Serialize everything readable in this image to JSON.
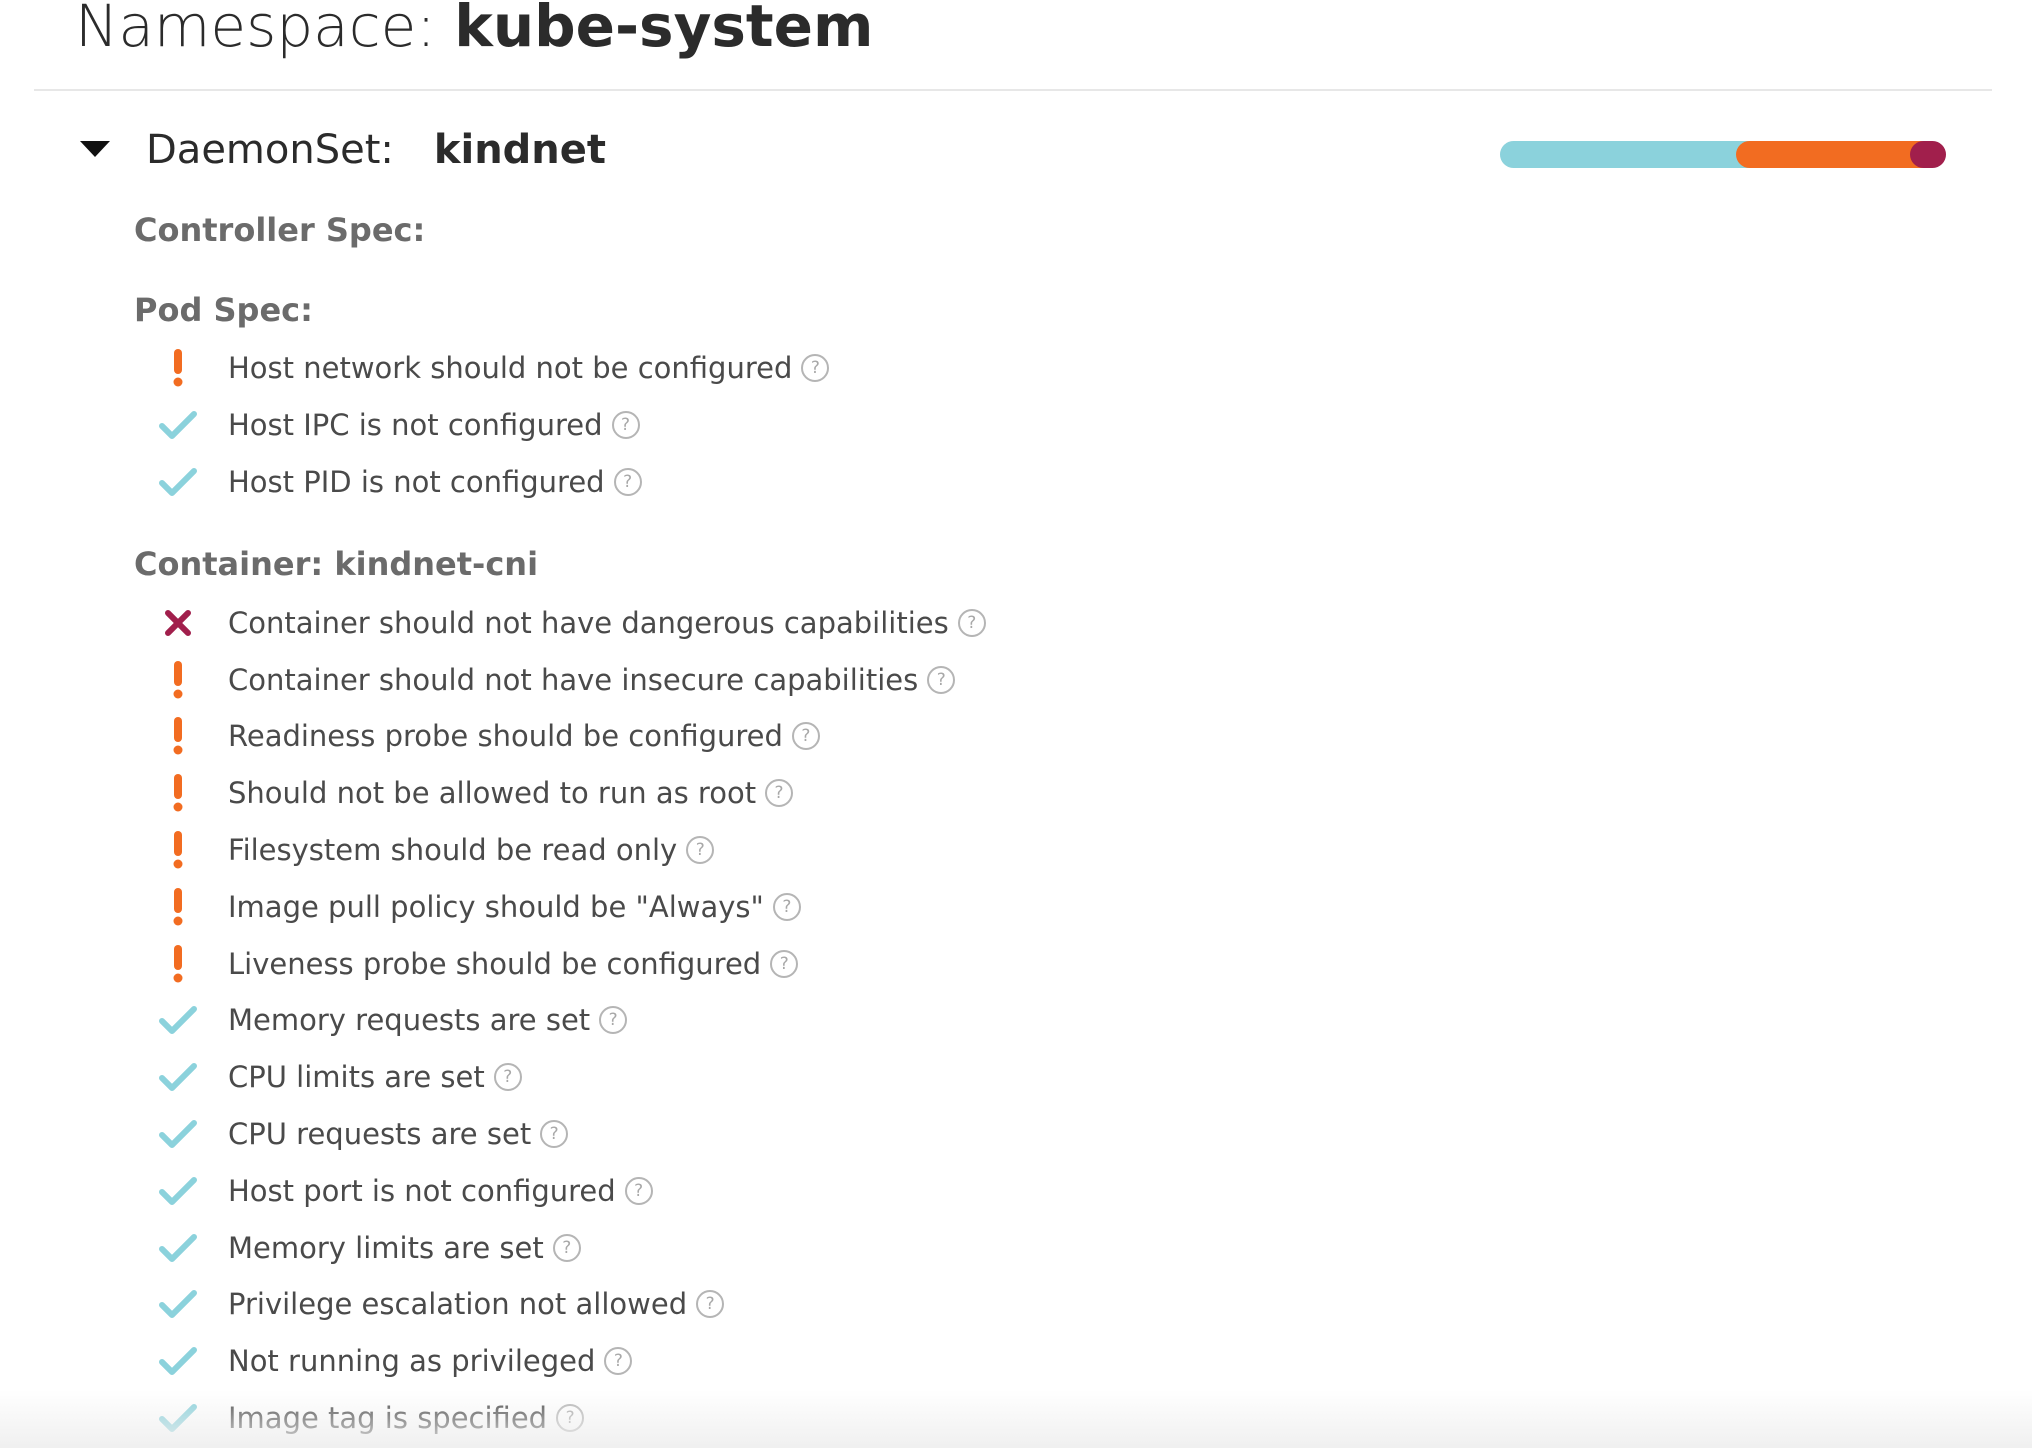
{
  "namespace": {
    "label": "Namespace:",
    "name": "kube-system"
  },
  "controller": {
    "kind_label": "DaemonSet:",
    "name": "kindnet",
    "expanded": true,
    "toggle_icon": "caret-down-icon",
    "score_bar": {
      "success_fraction": 0.56,
      "warning_fraction": 0.39,
      "danger_fraction": 0.05,
      "colors": {
        "success": "#8bd2dc",
        "warning": "#f26c21",
        "danger": "#a11f4c"
      }
    }
  },
  "sections": {
    "controller_spec": "Controller Spec:",
    "pod_spec": "Pod Spec:",
    "container": "Container: kindnet-cni"
  },
  "pod_checks": [
    {
      "status": "warning",
      "icon": "exclamation-icon",
      "text": "Host network should not be configured"
    },
    {
      "status": "success",
      "icon": "checkmark-icon",
      "text": "Host IPC is not configured"
    },
    {
      "status": "success",
      "icon": "checkmark-icon",
      "text": "Host PID is not configured"
    }
  ],
  "container_checks": [
    {
      "status": "danger",
      "icon": "x-icon",
      "text": "Container should not have dangerous capabilities"
    },
    {
      "status": "warning",
      "icon": "exclamation-icon",
      "text": "Container should not have insecure capabilities"
    },
    {
      "status": "warning",
      "icon": "exclamation-icon",
      "text": "Readiness probe should be configured"
    },
    {
      "status": "warning",
      "icon": "exclamation-icon",
      "text": "Should not be allowed to run as root"
    },
    {
      "status": "warning",
      "icon": "exclamation-icon",
      "text": "Filesystem should be read only"
    },
    {
      "status": "warning",
      "icon": "exclamation-icon",
      "text": "Image pull policy should be \"Always\""
    },
    {
      "status": "warning",
      "icon": "exclamation-icon",
      "text": "Liveness probe should be configured"
    },
    {
      "status": "success",
      "icon": "checkmark-icon",
      "text": "Memory requests are set"
    },
    {
      "status": "success",
      "icon": "checkmark-icon",
      "text": "CPU limits are set"
    },
    {
      "status": "success",
      "icon": "checkmark-icon",
      "text": "CPU requests are set"
    },
    {
      "status": "success",
      "icon": "checkmark-icon",
      "text": "Host port is not configured"
    },
    {
      "status": "success",
      "icon": "checkmark-icon",
      "text": "Memory limits are set"
    },
    {
      "status": "success",
      "icon": "checkmark-icon",
      "text": "Privilege escalation not allowed"
    },
    {
      "status": "success",
      "icon": "checkmark-icon",
      "text": "Not running as privileged"
    },
    {
      "status": "success",
      "icon": "checkmark-icon",
      "text": "Image tag is specified"
    }
  ],
  "help_icon": {
    "name": "help-icon",
    "glyph": "?"
  },
  "status_colors": {
    "success": "#8bd2dc",
    "warning": "#f26c21",
    "danger": "#a11f4c"
  }
}
